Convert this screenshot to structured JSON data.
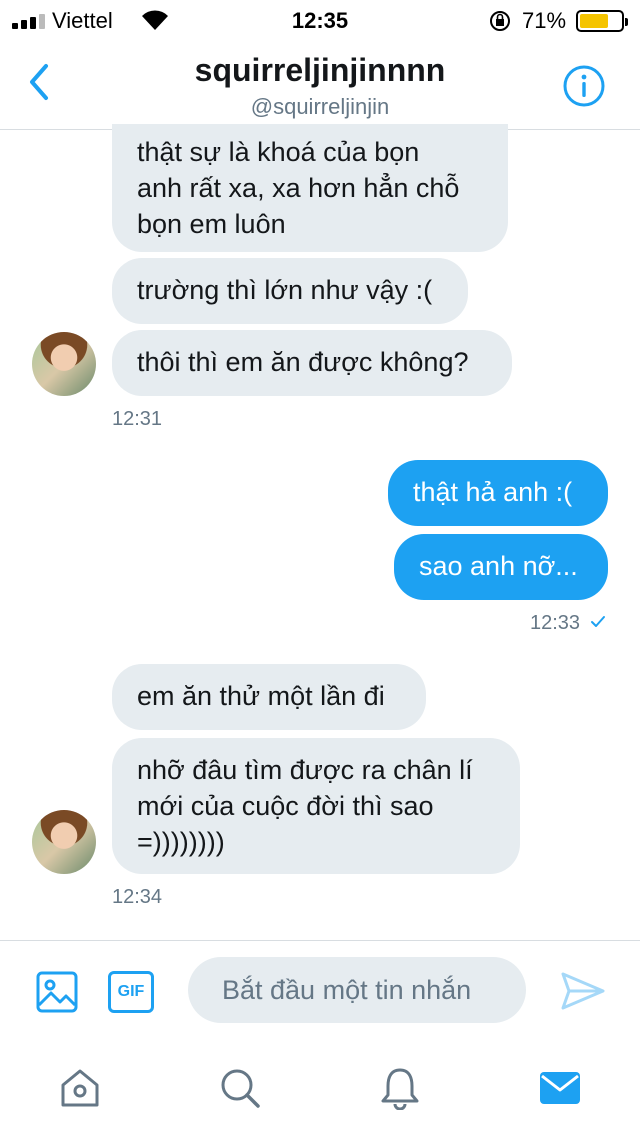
{
  "status_bar": {
    "carrier": "Viettel",
    "time": "12:35",
    "battery": "71%",
    "battery_level": 0.71,
    "battery_color": "#f5c400"
  },
  "header": {
    "name": "squirreljinjinnnn",
    "handle": "@squirreljinjin",
    "back_icon": "chevron-left-icon",
    "info_icon": "info-icon"
  },
  "messages": [
    {
      "direction": "in",
      "text": [
        "thật sự là khoá của bọn",
        "anh rất xa, xa hơn hẳn chỗ",
        "bọn em luôn"
      ]
    },
    {
      "direction": "in",
      "text": [
        "trường thì lớn như vậy :("
      ]
    },
    {
      "direction": "in",
      "text": [
        "thôi thì em ăn được không?"
      ]
    },
    {
      "type": "timestamp",
      "text": "12:31"
    },
    {
      "direction": "out",
      "text": [
        "thật hả anh :("
      ]
    },
    {
      "direction": "out",
      "text": [
        "sao anh nỡ..."
      ]
    },
    {
      "type": "timestamp",
      "text": "12:33"
    },
    {
      "direction": "in",
      "text": [
        "em ăn thử một lần đi"
      ]
    },
    {
      "direction": "in",
      "text": [
        "nhỡ đâu tìm được ra chân lí",
        "mới của cuộc đời thì sao",
        "=))))))))"
      ]
    },
    {
      "type": "timestamp",
      "text": "12:34"
    }
  ],
  "composer": {
    "placeholder": "Bắt đầu một tin nhắn",
    "gif_label": "GIF"
  },
  "colors": {
    "accent": "#1da1f2",
    "incoming_bubble": "#e6ecf0",
    "muted_text": "#657786"
  },
  "tabs": [
    "home-icon",
    "search-icon",
    "notifications-icon",
    "messages-icon"
  ]
}
